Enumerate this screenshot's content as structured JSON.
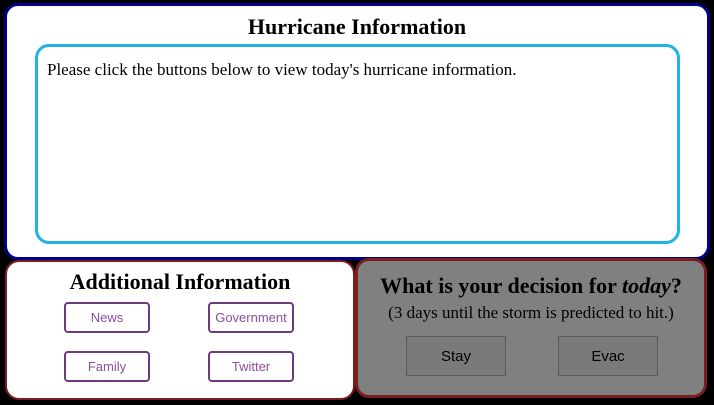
{
  "hurricane": {
    "title": "Hurricane Information",
    "message": "Please click the buttons below to view today's hurricane information."
  },
  "additional": {
    "title": "Additional Information",
    "buttons": [
      "News",
      "Government",
      "Family",
      "Twitter"
    ]
  },
  "decision": {
    "title_prefix": "What is your decision for ",
    "title_emphasis": "today",
    "title_suffix": "?",
    "subtitle": "(3 days until the storm is predicted to hit.)",
    "stay_label": "Stay",
    "evac_label": "Evac"
  },
  "colors": {
    "top_border": "#00008b",
    "info_border": "#1eb4e6",
    "panel_border": "#7a1f1f",
    "decision_bg": "#808080",
    "info_button_text": "#8a4f9a"
  }
}
